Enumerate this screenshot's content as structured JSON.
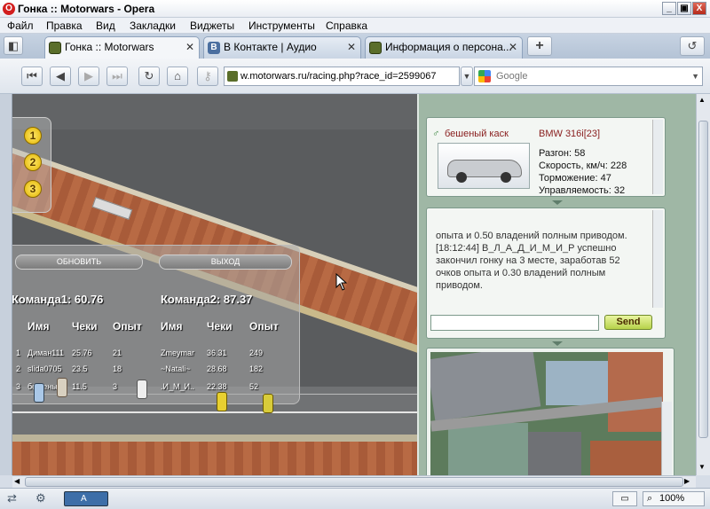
{
  "window": {
    "title": "Гонка :: Motorwars - Opera",
    "icon": "opera-icon",
    "min": "_",
    "max": "▣",
    "close": "X"
  },
  "menu": [
    "Файл",
    "Правка",
    "Вид",
    "Закладки",
    "Виджеты",
    "Инструменты",
    "Справка"
  ],
  "tabs": [
    {
      "label": "Гонка :: Motorwars",
      "close": "✕",
      "active": true
    },
    {
      "label": "В Контакте | Аудио",
      "close": "✕",
      "active": false
    },
    {
      "label": "Информация о персона...",
      "close": "✕",
      "active": false
    }
  ],
  "nav": {
    "url": "w.motorwars.ru/racing.php?race_id=2599067",
    "search_placeholder": "Google"
  },
  "game": {
    "positions": [
      "1",
      "2",
      "3"
    ],
    "buttons": {
      "refresh": "ОБНОВИТЬ",
      "exit": "ВЫХОД"
    },
    "team1": "Команда1: 60.76",
    "team2": "Команда2: 87.37",
    "headers": [
      "Имя",
      "Чеки",
      "Опыт"
    ],
    "team1_rows": [
      {
        "n": "1",
        "name": "Диман111",
        "checks": "25.76",
        "exp": "21"
      },
      {
        "n": "2",
        "name": "slida0705",
        "checks": "23.5",
        "exp": "18"
      },
      {
        "n": "3",
        "name": "бешеный",
        "checks": "11.5",
        "exp": "3"
      }
    ],
    "team2_rows": [
      {
        "name": "Zmeymar",
        "checks": "36.31",
        "exp": "249"
      },
      {
        "name": "~Natali~",
        "checks": "28.68",
        "exp": "182"
      },
      {
        "name": ".И_М_И..",
        "checks": "22.38",
        "exp": "52"
      }
    ]
  },
  "car": {
    "owner": "бешеный каск",
    "model": "BMW 316i[23]",
    "stats": [
      "Разгон: 58",
      "Скорость, км/ч: 228",
      "Торможение: 47",
      "Управляемость: 32"
    ]
  },
  "chat": {
    "text": "опыта и 0.50 владений полным приводом. [18:12:44] В_Л_А_Д_И_М_И_Р успешно закончил гонку на 3 месте, заработав 52 очков опыта и 0.30 владений полным приводом.",
    "send": "Send"
  },
  "status": {
    "lang": "A",
    "zoom": "100%"
  }
}
